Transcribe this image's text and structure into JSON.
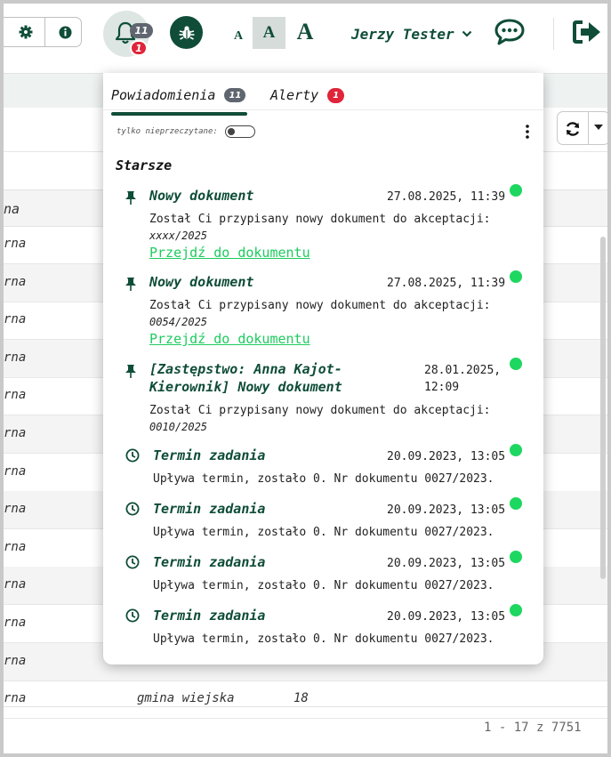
{
  "header": {
    "user_name": "Jerzy Tester",
    "notif_count": "11",
    "alert_count": "1",
    "font_small": "A",
    "font_medium": "A",
    "font_large": "A"
  },
  "table": {
    "column_header": "na",
    "rows": [
      {
        "c1": "rna",
        "c2": "",
        "c3": ""
      },
      {
        "c1": "rna",
        "c2": "",
        "c3": ""
      },
      {
        "c1": "rna",
        "c2": "",
        "c3": ""
      },
      {
        "c1": "rna",
        "c2": "",
        "c3": ""
      },
      {
        "c1": "rna",
        "c2": "",
        "c3": ""
      },
      {
        "c1": "rna",
        "c2": "",
        "c3": ""
      },
      {
        "c1": "rna",
        "c2": "",
        "c3": ""
      },
      {
        "c1": "rna",
        "c2": "",
        "c3": ""
      },
      {
        "c1": "rna",
        "c2": "",
        "c3": ""
      },
      {
        "c1": "rna",
        "c2": "",
        "c3": ""
      },
      {
        "c1": "rna",
        "c2": "",
        "c3": ""
      },
      {
        "c1": "rna",
        "c2": "",
        "c3": ""
      },
      {
        "c1": "rna",
        "c2": "gmina wiejska",
        "c3": "18"
      }
    ],
    "pagination": "1 - 17 z 7751"
  },
  "popup": {
    "tabs": [
      {
        "label": "Powiadomienia",
        "badge": "11"
      },
      {
        "label": "Alerty",
        "badge": "1"
      }
    ],
    "unread_only_label": "tylko nieprzeczytane:",
    "section_title": "Starsze",
    "notifications": [
      {
        "icon": "pin-icon",
        "title": "Nowy dokument",
        "date": "27.08.2025, 11:39",
        "body": "Został Ci przypisany nowy dokument do akceptacji:",
        "doc": "xxxx/2025",
        "link": "Przejdź do dokumentu"
      },
      {
        "icon": "pin-icon",
        "title": "Nowy dokument",
        "date": "27.08.2025, 11:39",
        "body": "Został Ci przypisany nowy dokument do akceptacji:",
        "doc": "0054/2025",
        "link": "Przejdź do dokumentu"
      },
      {
        "icon": "pin-icon",
        "title_line1": "[Zastępstwo: Anna Kajot-",
        "title_line2": "Kierownik] Nowy dokument",
        "date_line1": "28.01.2025,",
        "date_line2": "12:09",
        "body": "Został Ci przypisany nowy dokument do akceptacji:",
        "doc": "0010/2025"
      },
      {
        "icon": "clock-icon",
        "title": "Termin zadania",
        "date": "20.09.2023, 13:05",
        "body": "Upływa termin, zostało 0. Nr dokumentu 0027/2023."
      },
      {
        "icon": "clock-icon",
        "title": "Termin zadania",
        "date": "20.09.2023, 13:05",
        "body": "Upływa termin, zostało 0. Nr dokumentu 0027/2023."
      },
      {
        "icon": "clock-icon",
        "title": "Termin zadania",
        "date": "20.09.2023, 13:05",
        "body": "Upływa termin, zostało 0. Nr dokumentu 0027/2023."
      },
      {
        "icon": "clock-icon",
        "title": "Termin zadania",
        "date": "20.09.2023, 13:05",
        "body": "Upływa termin, zostało 0. Nr dokumentu 0027/2023."
      }
    ]
  },
  "colors": {
    "brand": "#0f4d38",
    "unread_dot": "#1ed760",
    "link": "#1ecb5f",
    "alert_badge": "#e0243a"
  }
}
